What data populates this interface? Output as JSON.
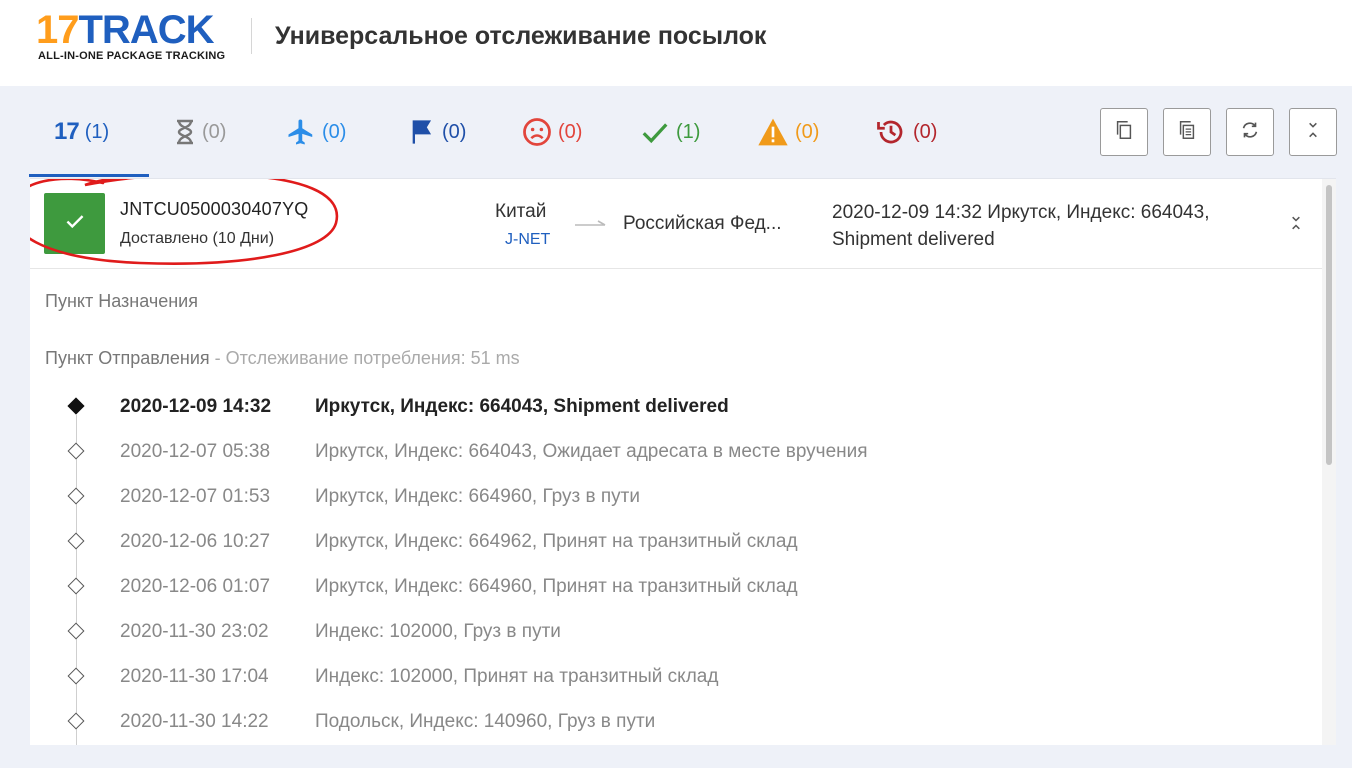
{
  "header": {
    "logo_text_17": "17",
    "logo_text_track": "TRACK",
    "logo_tagline": "ALL-IN-ONE PACKAGE TRACKING",
    "title": "Универсальное отслеживание посылок"
  },
  "tabs": [
    {
      "icon": "17-logo-icon",
      "count": "(1)",
      "color": "#1f5fbf"
    },
    {
      "icon": "hourglass-icon",
      "count": "(0)",
      "color": "#999999"
    },
    {
      "icon": "airplane-icon",
      "count": "(0)",
      "color": "#2b8de8"
    },
    {
      "icon": "flag-icon",
      "count": "(0)",
      "color": "#1f4fa8"
    },
    {
      "icon": "sad-face-icon",
      "count": "(0)",
      "color": "#e2453c"
    },
    {
      "icon": "checkmark-icon",
      "count": "(1)",
      "color": "#3e9a3e"
    },
    {
      "icon": "warning-icon",
      "count": "(0)",
      "color": "#f09a1a"
    },
    {
      "icon": "history-icon",
      "count": "(0)",
      "color": "#b3262d"
    }
  ],
  "toolbar": [
    {
      "icon": "copy-icon"
    },
    {
      "icon": "copy-list-icon"
    },
    {
      "icon": "refresh-icon"
    },
    {
      "icon": "collapse-icon"
    }
  ],
  "package": {
    "tracking_number": "JNTCU0500030407YQ",
    "status": "Доставлено (10 Дни)",
    "status_color": "#3e9a3e",
    "origin": "Китай",
    "carrier": "J-NET",
    "destination": "Российская Фед...",
    "latest_event": "2020-12-09 14:32  Иркутск, Индекс: 664043, Shipment delivered"
  },
  "sections": {
    "destination_label": "Пункт Назначения",
    "origin_label": "Пункт Отправления",
    "origin_note": " - Отслеживание потребления: 51 ms"
  },
  "events": [
    {
      "date": "2020-12-09 14:32",
      "desc": "Иркутск, Индекс: 664043, Shipment delivered"
    },
    {
      "date": "2020-12-07 05:38",
      "desc": "Иркутск, Индекс: 664043, Ожидает адресата в месте вручения"
    },
    {
      "date": "2020-12-07 01:53",
      "desc": "Иркутск, Индекс: 664960, Груз в пути"
    },
    {
      "date": "2020-12-06 10:27",
      "desc": "Иркутск, Индекс: 664962, Принят на транзитный склад"
    },
    {
      "date": "2020-12-06 01:07",
      "desc": "Иркутск, Индекс: 664960, Принят на транзитный склад"
    },
    {
      "date": "2020-11-30 23:02",
      "desc": "Индекс: 102000, Груз в пути"
    },
    {
      "date": "2020-11-30 17:04",
      "desc": "Индекс: 102000, Принят на транзитный склад"
    },
    {
      "date": "2020-11-30 14:22",
      "desc": "Подольск, Индекс: 140960, Груз в пути"
    }
  ]
}
